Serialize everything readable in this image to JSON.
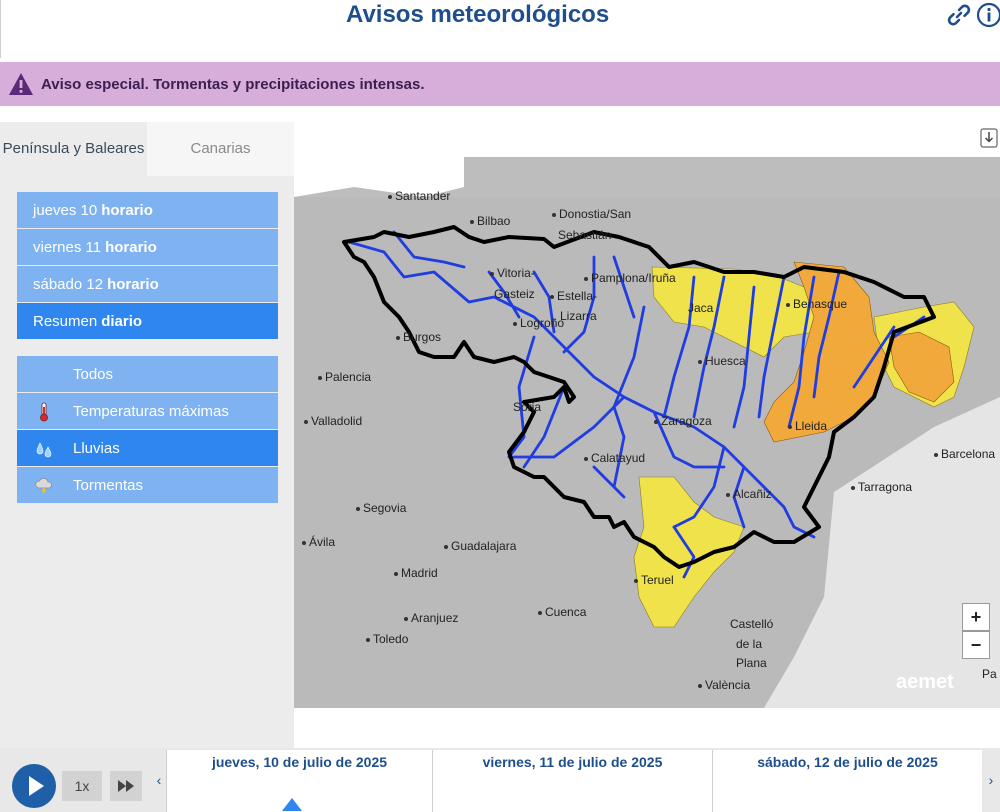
{
  "header": {
    "title": "Avisos meteorológicos",
    "link_icon": "link-icon",
    "info_icon": "info-icon"
  },
  "alert": {
    "icon": "warning-triangle-icon",
    "text": "Aviso especial. Tormentas y precipitaciones intensas.",
    "color": "#d6aed9"
  },
  "region_tabs": [
    {
      "label": "Península y Baleares",
      "active": true
    },
    {
      "label": "Canarias",
      "active": false
    }
  ],
  "days": [
    {
      "day": "jueves 10",
      "mode": "horario",
      "selected": false
    },
    {
      "day": "viernes 11",
      "mode": "horario",
      "selected": false
    },
    {
      "day": "sábado 12",
      "mode": "horario",
      "selected": false
    },
    {
      "day": "Resumen",
      "mode": "diario",
      "selected": true
    }
  ],
  "layers": [
    {
      "label": "Todos",
      "icon": "",
      "selected": false
    },
    {
      "label": "Temperaturas máximas",
      "icon": "thermometer-icon",
      "selected": false
    },
    {
      "label": "Lluvias",
      "icon": "rain-drops-icon",
      "selected": true
    },
    {
      "label": "Tormentas",
      "icon": "storm-cloud-icon",
      "selected": false
    }
  ],
  "map": {
    "download_icon": "download-icon",
    "zoom_in": "+",
    "zoom_out": "−",
    "logo": "aemet",
    "colors": {
      "yellow": "#f0e24b",
      "orange": "#f2a93b",
      "river": "#1f3de0",
      "boundary": "#000000",
      "land": "#bdbdbd"
    },
    "cities": [
      "Santander",
      "Bilbao",
      "Donostia/San",
      "Sebastián",
      "Vitoria-",
      "Gasteiz",
      "Pamplona/Iruña",
      "Estella-",
      "Lizarra",
      "Logroño",
      "Jaca",
      "Benasque",
      "Burgos",
      "Huesca",
      "Palencia",
      "Valladolid",
      "Soria",
      "Zaragoza",
      "Lleida",
      "Barcelona",
      "Calatayud",
      "Alcañiz",
      "Tarragona",
      "Segovia",
      "Ávila",
      "Guadalajara",
      "Madrid",
      "Teruel",
      "Aranjuez",
      "Cuenca",
      "Toledo",
      "Castelló",
      "de la",
      "Plana",
      "València",
      "Pa"
    ]
  },
  "timeline": {
    "speed": "1x",
    "days": [
      "jueves, 10 de julio de 2025",
      "viernes, 11 de julio de 2025",
      "sábado, 12 de julio de 2025"
    ],
    "prev": "‹",
    "next": "›"
  }
}
